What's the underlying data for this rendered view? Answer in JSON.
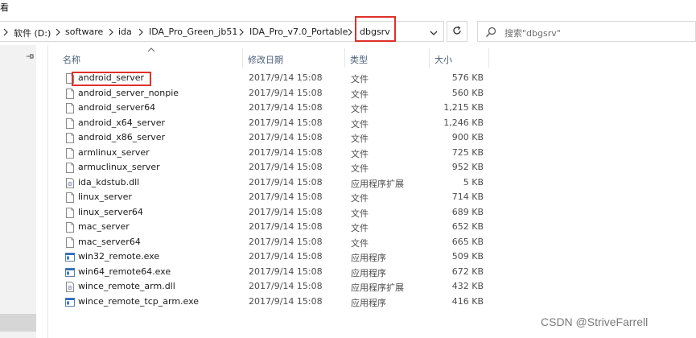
{
  "menu": {
    "view_label": "看"
  },
  "breadcrumb": {
    "items": [
      "软件 (D:)",
      "software",
      "ida",
      "IDA_Pro_Green_jb51",
      "IDA_Pro_v7.0_Portable"
    ],
    "current": "dbgsrv"
  },
  "search": {
    "placeholder": "搜索\"dbgsrv\""
  },
  "columns": {
    "name": "名称",
    "date": "修改日期",
    "type": "类型",
    "size": "大小"
  },
  "files": [
    {
      "name": "android_server",
      "date": "2017/9/14 15:08",
      "type": "文件",
      "size": "576 KB",
      "icon": "generic-file-icon"
    },
    {
      "name": "android_server_nonpie",
      "date": "2017/9/14 15:08",
      "type": "文件",
      "size": "560 KB",
      "icon": "generic-file-icon"
    },
    {
      "name": "android_server64",
      "date": "2017/9/14 15:08",
      "type": "文件",
      "size": "1,215 KB",
      "icon": "generic-file-icon"
    },
    {
      "name": "android_x64_server",
      "date": "2017/9/14 15:08",
      "type": "文件",
      "size": "1,246 KB",
      "icon": "generic-file-icon"
    },
    {
      "name": "android_x86_server",
      "date": "2017/9/14 15:08",
      "type": "文件",
      "size": "900 KB",
      "icon": "generic-file-icon"
    },
    {
      "name": "armlinux_server",
      "date": "2017/9/14 15:08",
      "type": "文件",
      "size": "725 KB",
      "icon": "generic-file-icon"
    },
    {
      "name": "armuclinux_server",
      "date": "2017/9/14 15:08",
      "type": "文件",
      "size": "952 KB",
      "icon": "generic-file-icon"
    },
    {
      "name": "ida_kdstub.dll",
      "date": "2017/9/14 15:08",
      "type": "应用程序扩展",
      "size": "5 KB",
      "icon": "dll-file-icon"
    },
    {
      "name": "linux_server",
      "date": "2017/9/14 15:08",
      "type": "文件",
      "size": "714 KB",
      "icon": "generic-file-icon"
    },
    {
      "name": "linux_server64",
      "date": "2017/9/14 15:08",
      "type": "文件",
      "size": "689 KB",
      "icon": "generic-file-icon"
    },
    {
      "name": "mac_server",
      "date": "2017/9/14 15:08",
      "type": "文件",
      "size": "652 KB",
      "icon": "generic-file-icon"
    },
    {
      "name": "mac_server64",
      "date": "2017/9/14 15:08",
      "type": "文件",
      "size": "665 KB",
      "icon": "generic-file-icon"
    },
    {
      "name": "win32_remote.exe",
      "date": "2017/9/14 15:08",
      "type": "应用程序",
      "size": "509 KB",
      "icon": "exe-file-icon"
    },
    {
      "name": "win64_remote64.exe",
      "date": "2017/9/14 15:08",
      "type": "应用程序",
      "size": "672 KB",
      "icon": "exe-file-icon"
    },
    {
      "name": "wince_remote_arm.dll",
      "date": "2017/9/14 15:08",
      "type": "应用程序扩展",
      "size": "432 KB",
      "icon": "dll-file-icon"
    },
    {
      "name": "wince_remote_tcp_arm.exe",
      "date": "2017/9/14 15:08",
      "type": "应用程序",
      "size": "416 KB",
      "icon": "exe-file-icon"
    }
  ],
  "watermark": "CSDN @StriveFarrell",
  "colors": {
    "highlight": "#e0302a",
    "header_text": "#4c607a"
  }
}
